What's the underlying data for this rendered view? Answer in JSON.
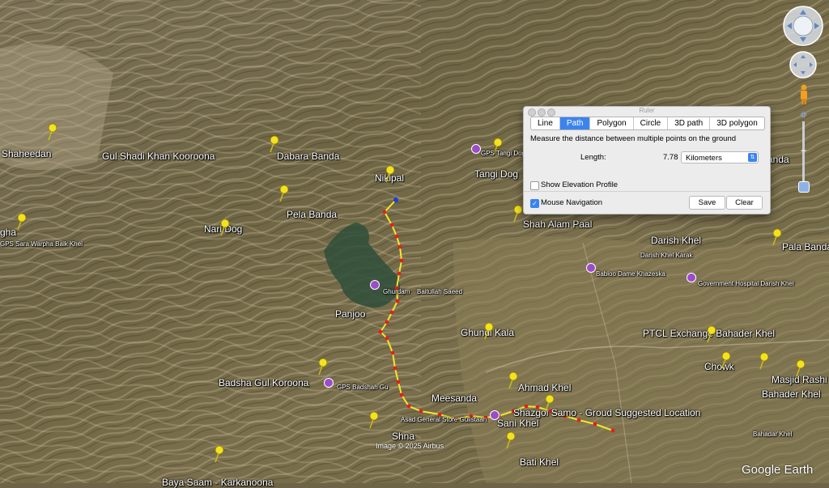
{
  "map": {
    "places": [
      {
        "name": "Shaheedan",
        "size": "normal"
      },
      {
        "name": "Gul Shadi Khan Kooroona",
        "size": "normal"
      },
      {
        "name": "Dabara Banda",
        "size": "normal"
      },
      {
        "name": "Nikipal",
        "size": "normal"
      },
      {
        "name": "Tangi Dog",
        "size": "normal"
      },
      {
        "name": "GPS Tangi Dog",
        "size": "small"
      },
      {
        "name": "Pela Banda",
        "size": "normal"
      },
      {
        "name": "Shah Alam Paal",
        "size": "normal"
      },
      {
        "name": "gha",
        "size": "normal"
      },
      {
        "name": "GPS Sara Warpha Baik Khel",
        "size": "small"
      },
      {
        "name": "Nari Dog",
        "size": "normal"
      },
      {
        "name": "Darish Khel",
        "size": "normal"
      },
      {
        "name": "Pala Banda",
        "size": "normal"
      },
      {
        "name": "Darish Khel Karak",
        "size": "small"
      },
      {
        "name": "Babloo Dame Khazeska",
        "size": "small"
      },
      {
        "name": "Government Hospital Darish Khel",
        "size": "small"
      },
      {
        "name": "Ghurdam",
        "size": "small"
      },
      {
        "name": "Baitullah Saeed",
        "size": "small"
      },
      {
        "name": "Panjoo",
        "size": "normal"
      },
      {
        "name": "Ghundi Kala",
        "size": "normal"
      },
      {
        "name": "PTCL Exchange Bahader Khel",
        "size": "normal"
      },
      {
        "name": "Chowk",
        "size": "normal"
      },
      {
        "name": "Masjid Rashi",
        "size": "normal"
      },
      {
        "name": "Bahader Khel",
        "size": "normal"
      },
      {
        "name": "Badsha Gul Koroona",
        "size": "normal"
      },
      {
        "name": "GPS Badshah Gu",
        "size": "small"
      },
      {
        "name": "Ahmad Khel",
        "size": "normal"
      },
      {
        "name": "Meesanda",
        "size": "normal"
      },
      {
        "name": "Shazgoi Samo - Groud Suggested Location",
        "size": "normal"
      },
      {
        "name": "Asad General Store Gulistaan",
        "size": "small"
      },
      {
        "name": "Sani Khel",
        "size": "normal"
      },
      {
        "name": "Shna",
        "size": "normal"
      },
      {
        "name": "Bahadar Khel",
        "size": "small"
      },
      {
        "name": "Bati Khel",
        "size": "normal"
      },
      {
        "name": "Baya Saam - Karkanoona",
        "size": "normal"
      },
      {
        "name": "anda",
        "size": "normal"
      }
    ],
    "copyright": "Image © 2025 Airbus",
    "logo": "Google Earth",
    "route_color": "#f2e62a",
    "route_point_color": "#e02020",
    "pin_color": "#f3e21d"
  },
  "ruler": {
    "window_title": "Ruler",
    "tabs": [
      "Line",
      "Path",
      "Polygon",
      "Circle",
      "3D path",
      "3D polygon"
    ],
    "active_tab": "Path",
    "description": "Measure the distance between multiple points on the ground",
    "length_label": "Length:",
    "length_value": "7.78",
    "unit": "Kilometers",
    "show_elevation_label": "Show Elevation Profile",
    "show_elevation_checked": false,
    "mouse_nav_label": "Mouse Navigation",
    "mouse_nav_checked": true,
    "save_label": "Save",
    "clear_label": "Clear"
  },
  "nav": {
    "look_icon": "look-around-icon",
    "move_icon": "move-icon",
    "zoom_plus": "+",
    "zoom_minus": "−",
    "pegman_icon": "pegman-icon"
  }
}
